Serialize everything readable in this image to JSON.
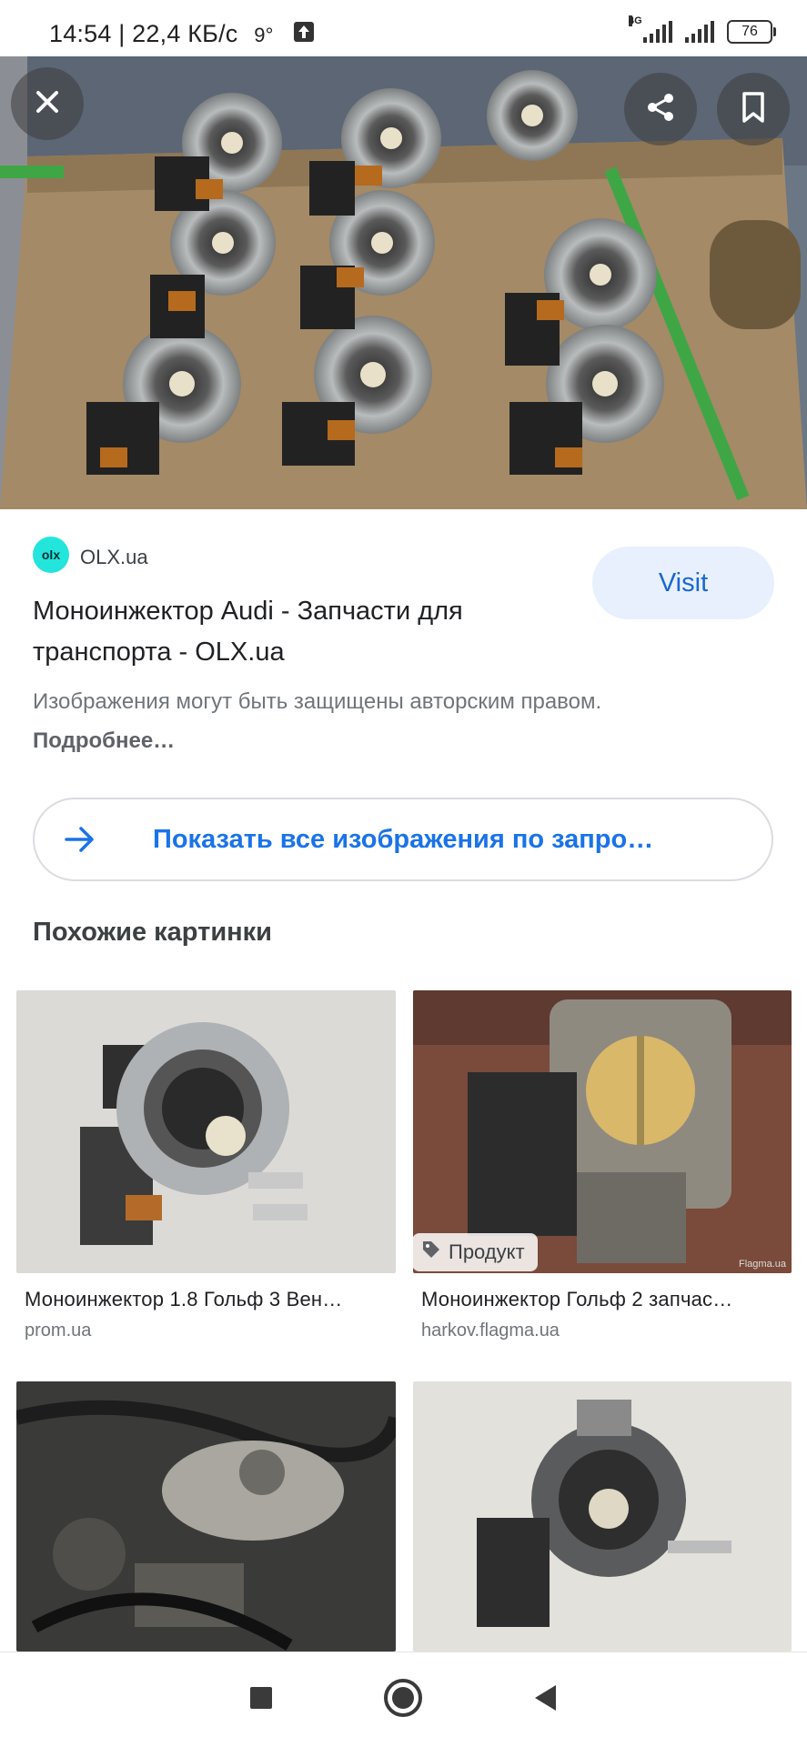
{
  "status_bar": {
    "time_speed": "14:54 | 22,4 КБ/с",
    "temperature": "9°",
    "network_label": "4G",
    "battery": "76"
  },
  "hero": {
    "icons": {
      "close": "close-icon",
      "share": "share-icon",
      "bookmark": "bookmark-icon"
    }
  },
  "result": {
    "source_logo": "olx",
    "source_name": "OLX.ua",
    "title": "Моноинжектор Audi - Запчасти для транспорта - OLX.ua",
    "copyright_text": "Изображения могут быть защищены авторским правом.",
    "copyright_link": "Подробнее…",
    "visit_label": "Visit"
  },
  "show_all": {
    "label": "Показать все изображения по запро…"
  },
  "similar": {
    "heading": "Похожие картинки",
    "items": [
      {
        "title": "Моноинжектор 1.8 Гольф 3 Вен…",
        "source": "prom.ua"
      },
      {
        "title": "Моноинжектор Гольф 2 запчас…",
        "source": "harkov.flagma.ua",
        "badge": "Продукт",
        "watermark": "Flagma.ua"
      }
    ]
  },
  "colors": {
    "accent": "#1a73e8",
    "visit_bg": "#e8f0fe",
    "olx": "#23e5db"
  }
}
